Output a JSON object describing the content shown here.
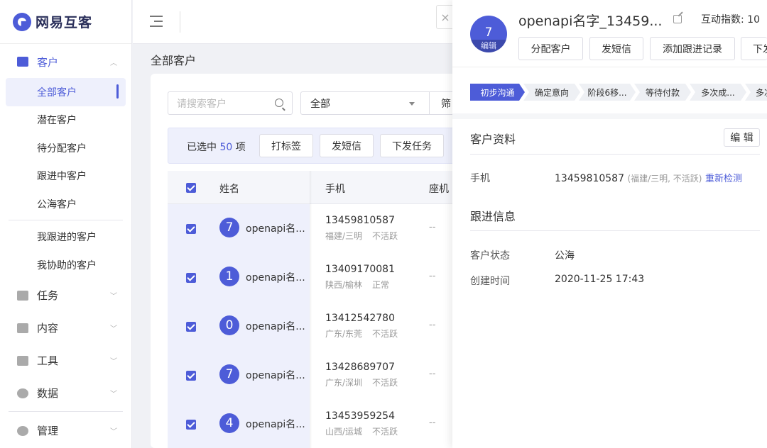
{
  "app": {
    "name": "网易互客"
  },
  "sidebar": {
    "customer_group": "客户",
    "customer_items": [
      {
        "label": "全部客户"
      },
      {
        "label": "潜在客户"
      },
      {
        "label": "待分配客户"
      },
      {
        "label": "跟进中客户"
      },
      {
        "label": "公海客户"
      },
      {
        "label": "我跟进的客户"
      },
      {
        "label": "我协助的客户"
      }
    ],
    "groups": [
      {
        "label": "任务",
        "icon": "task-icon"
      },
      {
        "label": "内容",
        "icon": "content-icon"
      },
      {
        "label": "工具",
        "icon": "tools-icon"
      },
      {
        "label": "数据",
        "icon": "data-icon"
      },
      {
        "label": "管理",
        "icon": "gear-icon"
      }
    ]
  },
  "main": {
    "page_title": "全部客户",
    "search_placeholder": "请搜索客户",
    "filter_select": "全部",
    "filter_button": "筛",
    "batch": {
      "selected_prefix": "已选中",
      "selected_count": "50",
      "selected_suffix": "项",
      "actions": [
        "打标签",
        "发短信",
        "下发任务"
      ]
    },
    "table": {
      "headers": [
        "姓名",
        "手机",
        "座机"
      ],
      "rows": [
        {
          "avatar": "7",
          "name": "openapi名...",
          "phone": "13459810587",
          "location": "福建/三明",
          "status": "不活跃",
          "landline": "--"
        },
        {
          "avatar": "1",
          "name": "openapi名...",
          "phone": "13409170081",
          "location": "陕西/榆林",
          "status": "正常",
          "landline": "--"
        },
        {
          "avatar": "0",
          "name": "openapi名...",
          "phone": "13412542780",
          "location": "广东/东莞",
          "status": "不活跃",
          "landline": "--"
        },
        {
          "avatar": "7",
          "name": "openapi名...",
          "phone": "13428689707",
          "location": "广东/深圳",
          "status": "不活跃",
          "landline": "--"
        },
        {
          "avatar": "4",
          "name": "openapi名...",
          "phone": "13453959254",
          "location": "山西/运城",
          "status": "不活跃",
          "landline": "--"
        }
      ]
    }
  },
  "drawer": {
    "close_icon": "×",
    "avatar_number": "7",
    "avatar_edit": "编辑",
    "title": "openapi名字_13459...",
    "interaction_label": "互动指数:",
    "interaction_value": "10",
    "actions": [
      "分配客户",
      "发短信",
      "添加跟进记录",
      "下发"
    ],
    "stages": [
      "初步沟通",
      "确定意向",
      "阶段6移...",
      "等待付款",
      "多次成...",
      "多次"
    ],
    "profile": {
      "section_title": "客户资料",
      "edit_label": "编 辑",
      "phone_label": "手机",
      "phone_value": "13459810587",
      "phone_note": "(福建/三明, 不活跃)",
      "recheck_link": "重新检测"
    },
    "followup": {
      "section_title": "跟进信息",
      "status_label": "客户状态",
      "status_value": "公海",
      "created_label": "创建时间",
      "created_value": "2020-11-25 17:43"
    }
  },
  "colors": {
    "accent": "#4d5cd8",
    "selected_bg": "#eef0fc"
  }
}
